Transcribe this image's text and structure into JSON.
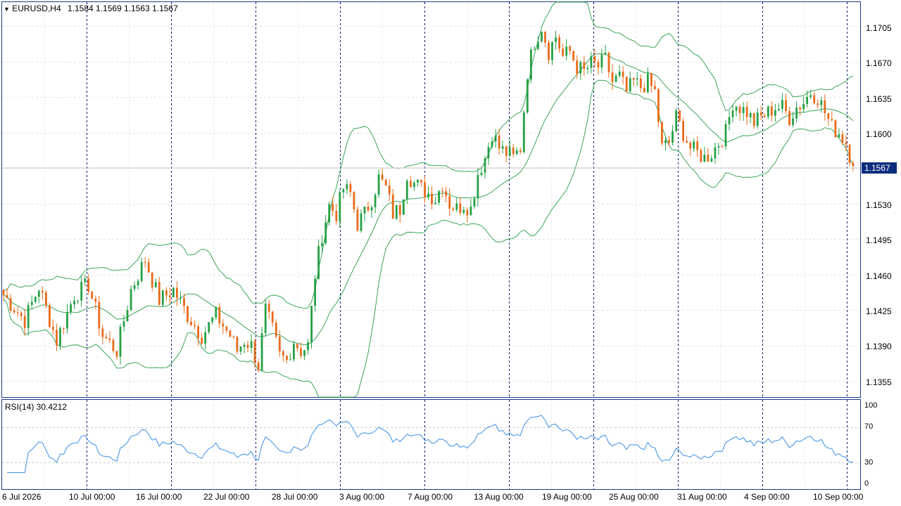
{
  "header": {
    "symbol_label": "EURUSD,H4",
    "quote": "1.1584 1.1569 1.1563 1.1567"
  },
  "rsi_panel": {
    "label": "RSI(14) 30.4212"
  },
  "current_price": "1.1567",
  "colors": {
    "bull": "#26a046",
    "bear": "#e86a1a",
    "bands": "#3aa658",
    "rsi": "#3a8ee6",
    "frame": "#1c3a8e",
    "price_tag": "#0d2e7e"
  },
  "price_axis": [
    "1.1705",
    "1.1670",
    "1.1635",
    "1.1600",
    "1.1530",
    "1.1495",
    "1.1460",
    "1.1425",
    "1.1390",
    "1.1355"
  ],
  "rsi_axis": [
    "100",
    "70",
    "30",
    "0"
  ],
  "time_axis": [
    "6 Jul 2026",
    "10 Jul 00:00",
    "16 Jul 00:00",
    "22 Jul 00:00",
    "28 Jul 00:00",
    "3 Aug 00:00",
    "7 Aug 00:00",
    "13 Aug 00:00",
    "19 Aug 00:00",
    "25 Aug 00:00",
    "31 Aug 00:00",
    "4 Sep 00:00",
    "10 Sep 00:00"
  ],
  "chart_data": {
    "type": "candlestick",
    "symbol": "EURUSD",
    "timeframe": "H4",
    "ylim": [
      1.134,
      1.1728
    ],
    "rsi_ylim": [
      0,
      100
    ],
    "rsi_levels": [
      70,
      30
    ],
    "close_path": [
      [
        0,
        1.144
      ],
      [
        6,
        1.1415
      ],
      [
        10,
        1.1448
      ],
      [
        15,
        1.1395
      ],
      [
        20,
        1.144
      ],
      [
        24,
        1.145
      ],
      [
        28,
        1.14
      ],
      [
        32,
        1.1385
      ],
      [
        36,
        1.1445
      ],
      [
        40,
        1.1475
      ],
      [
        44,
        1.1435
      ],
      [
        48,
        1.1445
      ],
      [
        52,
        1.142
      ],
      [
        56,
        1.14
      ],
      [
        60,
        1.142
      ],
      [
        64,
        1.14
      ],
      [
        66,
        1.1385
      ],
      [
        68,
        1.1395
      ],
      [
        70,
        1.139
      ],
      [
        72,
        1.137
      ],
      [
        74,
        1.1425
      ],
      [
        76,
        1.1405
      ],
      [
        78,
        1.138
      ],
      [
        80,
        1.1375
      ],
      [
        82,
        1.1395
      ],
      [
        84,
        1.1385
      ],
      [
        86,
        1.139
      ],
      [
        88,
        1.146
      ],
      [
        90,
        1.15
      ],
      [
        92,
        1.1528
      ],
      [
        94,
        1.152
      ],
      [
        96,
        1.1545
      ],
      [
        98,
        1.154
      ],
      [
        100,
        1.151
      ],
      [
        102,
        1.152
      ],
      [
        104,
        1.1535
      ],
      [
        106,
        1.1555
      ],
      [
        108,
        1.1545
      ],
      [
        110,
        1.152
      ],
      [
        112,
        1.1525
      ],
      [
        114,
        1.156
      ],
      [
        116,
        1.155
      ],
      [
        118,
        1.1545
      ],
      [
        120,
        1.154
      ],
      [
        122,
        1.1535
      ],
      [
        124,
        1.155
      ],
      [
        126,
        1.153
      ],
      [
        128,
        1.1525
      ],
      [
        130,
        1.153
      ],
      [
        132,
        1.1525
      ],
      [
        134,
        1.156
      ],
      [
        136,
        1.1575
      ],
      [
        138,
        1.16
      ],
      [
        140,
        1.1585
      ],
      [
        142,
        1.158
      ],
      [
        144,
        1.1575
      ],
      [
        146,
        1.1585
      ],
      [
        148,
        1.166
      ],
      [
        150,
        1.169
      ],
      [
        152,
        1.1705
      ],
      [
        154,
        1.168
      ],
      [
        156,
        1.1695
      ],
      [
        158,
        1.1675
      ],
      [
        160,
        1.168
      ],
      [
        162,
        1.1665
      ],
      [
        164,
        1.166
      ],
      [
        166,
        1.1668
      ],
      [
        168,
        1.1665
      ],
      [
        170,
        1.1672
      ],
      [
        172,
        1.165
      ],
      [
        174,
        1.1655
      ],
      [
        176,
        1.164
      ],
      [
        178,
        1.165
      ],
      [
        180,
        1.1645
      ],
      [
        182,
        1.165
      ],
      [
        184,
        1.164
      ],
      [
        186,
        1.1585
      ],
      [
        188,
        1.159
      ],
      [
        190,
        1.1615
      ],
      [
        192,
        1.16
      ],
      [
        194,
        1.1585
      ],
      [
        196,
        1.158
      ],
      [
        198,
        1.1575
      ],
      [
        200,
        1.158
      ],
      [
        202,
        1.159
      ],
      [
        204,
        1.16
      ],
      [
        206,
        1.163
      ],
      [
        208,
        1.1625
      ],
      [
        210,
        1.162
      ],
      [
        212,
        1.161
      ],
      [
        214,
        1.1615
      ],
      [
        216,
        1.162
      ],
      [
        218,
        1.1625
      ],
      [
        220,
        1.1625
      ],
      [
        222,
        1.1615
      ],
      [
        224,
        1.1625
      ],
      [
        226,
        1.163
      ],
      [
        228,
        1.164
      ],
      [
        230,
        1.1635
      ],
      [
        232,
        1.162
      ],
      [
        234,
        1.1605
      ],
      [
        236,
        1.16
      ],
      [
        238,
        1.159
      ],
      [
        240,
        1.1567
      ]
    ]
  }
}
